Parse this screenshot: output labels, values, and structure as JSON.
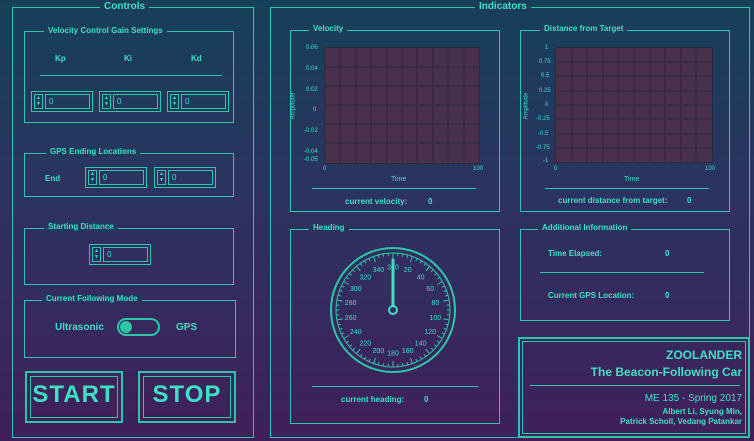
{
  "controls": {
    "title": "Controls",
    "velocity_gain": {
      "title": "Velocity Control Gain Settings",
      "labels": [
        "Kp",
        "Ki",
        "Kd"
      ],
      "values": [
        "0",
        "0",
        "0"
      ]
    },
    "gps_ending": {
      "title": "GPS Ending Locations",
      "end_label": "End",
      "values": [
        "0",
        "0"
      ]
    },
    "starting_distance": {
      "title": "Starting Distance",
      "value": "0"
    },
    "following_mode": {
      "title": "Current Following Mode",
      "left_label": "Ultrasonic",
      "right_label": "GPS"
    },
    "start_label": "START",
    "stop_label": "STOP"
  },
  "indicators": {
    "title": "Indicators",
    "velocity": {
      "title": "Velocity",
      "ylabel": "Amplitude",
      "xlabel": "Time",
      "yticks": [
        "0.06",
        "0.04",
        "0.02",
        "0",
        "-0.02",
        "-0.04",
        "-0.05"
      ],
      "xticks": [
        "0",
        "100"
      ],
      "readout_label": "current velocity:",
      "readout_value": "0"
    },
    "distance": {
      "title": "Distance from Target",
      "ylabel": "Amplitude",
      "xlabel": "Time",
      "yticks": [
        "1",
        "0.75",
        "0.5",
        "0.25",
        "0",
        "-0.25",
        "-0.5",
        "-0.75",
        "-1"
      ],
      "xticks": [
        "0",
        "100"
      ],
      "readout_label": "current distance from target:",
      "readout_value": "0"
    },
    "heading": {
      "title": "Heading",
      "dial_labels": [
        "360",
        "20",
        "40",
        "60",
        "80",
        "100",
        "120",
        "140",
        "160",
        "180",
        "200",
        "220",
        "240",
        "260",
        "280",
        "300",
        "320",
        "340"
      ],
      "readout_label": "current heading:",
      "readout_value": "0"
    },
    "additional": {
      "title": "Additional Information",
      "time_label": "Time Elapsed:",
      "time_value": "0",
      "gps_label": "Current GPS Location:",
      "gps_value": "0"
    }
  },
  "credits": {
    "project": "ZOOLANDER",
    "subtitle": "The Beacon-Following Car",
    "course": "ME 135 - Spring 2017",
    "authors_line1": "Albert Li, Syung Min,",
    "authors_line2": "Patrick Scholl, Vedang Patankar"
  }
}
